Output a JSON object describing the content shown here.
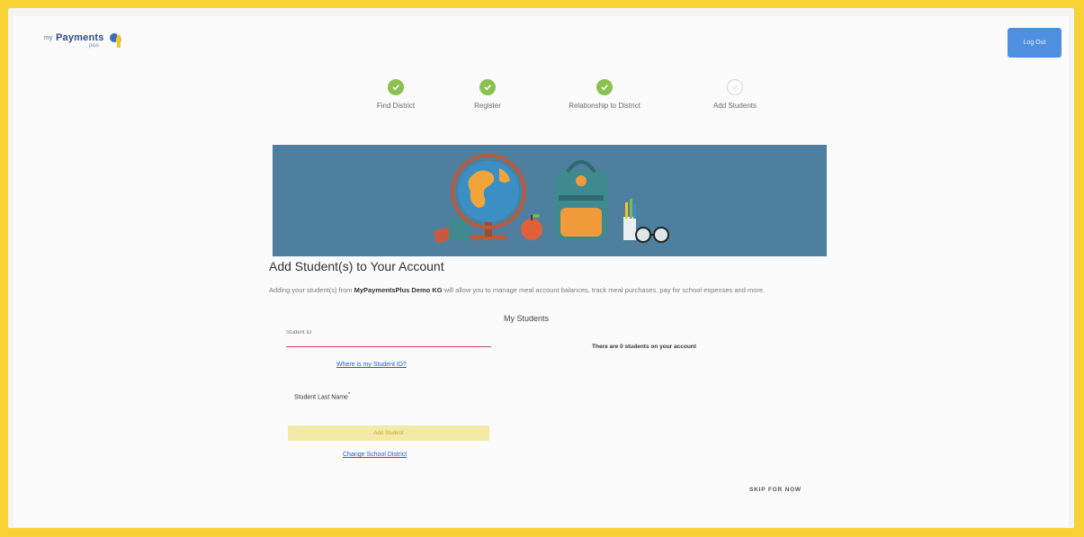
{
  "header": {
    "logo_prefix": "my",
    "logo_text": "Payments",
    "logo_suffix": "plus",
    "logout_label": "Log Out"
  },
  "steps": [
    {
      "label": "Find District",
      "status": "complete"
    },
    {
      "label": "Register",
      "status": "complete"
    },
    {
      "label": "Relationship to District",
      "status": "complete"
    },
    {
      "label": "Add Students",
      "status": "current"
    }
  ],
  "banner": {
    "icon": "school-supplies-illustration"
  },
  "main": {
    "title": "Add Student(s) to Your Account",
    "intro_prefix": "Adding your student(s) from ",
    "intro_district": "MyPaymentsPlus Demo KG",
    "intro_suffix": " will allow you to manage meal account balances, track meal purchases, pay for school expenses and more."
  },
  "form": {
    "student_id_placeholder": "Student ID",
    "where_link": "Where is my Student ID?",
    "last_name_label": "Student Last Name",
    "last_name_required_mark": "*",
    "add_button": "Add Student",
    "change_district_link": "Change School District"
  },
  "students_panel": {
    "title": "My Students",
    "empty_message": "There are 0 students on your account"
  },
  "footer": {
    "skip_label": "SKIP FOR NOW"
  },
  "colors": {
    "border_yellow": "#f8d232",
    "step_complete": "#8cc152",
    "primary_button": "#4e8fe0",
    "banner_bg": "#4e7f9e",
    "link": "#2b5fb8",
    "add_button_bg": "#f4eaa6"
  }
}
